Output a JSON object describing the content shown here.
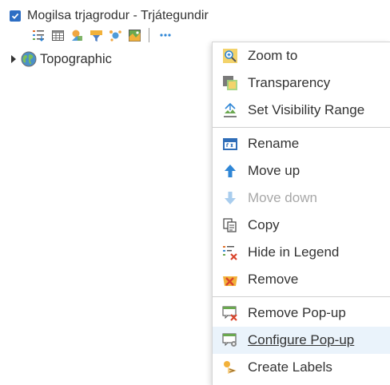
{
  "layer": {
    "title": "Mogilsa trjagrodur - Trjátegundir",
    "checked": true
  },
  "toolbar": {
    "icons": [
      "legend-list-icon",
      "table-icon",
      "shapes-icon",
      "filter-icon",
      "dots-cluster-icon",
      "image-icon"
    ],
    "more_label": "···"
  },
  "basemap": {
    "label": "Topographic"
  },
  "menu": {
    "items": [
      {
        "label": "Zoom to",
        "icon": "zoom-to-icon"
      },
      {
        "label": "Transparency",
        "icon": "transparency-icon"
      },
      {
        "label": "Set Visibility Range",
        "icon": "visibility-range-icon"
      },
      {
        "label": "Rename",
        "icon": "rename-icon"
      },
      {
        "label": "Move up",
        "icon": "arrow-up-icon"
      },
      {
        "label": "Move down",
        "icon": "arrow-down-icon",
        "disabled": true
      },
      {
        "label": "Copy",
        "icon": "copy-icon"
      },
      {
        "label": "Hide in Legend",
        "icon": "hide-legend-icon"
      },
      {
        "label": "Remove",
        "icon": "remove-icon"
      },
      {
        "label": "Remove Pop-up",
        "icon": "remove-popup-icon"
      },
      {
        "label": "Configure Pop-up",
        "icon": "configure-popup-icon",
        "highlighted": true
      },
      {
        "label": "Create Labels",
        "icon": "create-labels-icon"
      }
    ]
  },
  "colors": {
    "checkbox": "#2d6ec4",
    "highlight_bg": "#eaf3fb",
    "disabled_text": "#a8a8a8",
    "arrow_blue": "#2f86d6"
  }
}
